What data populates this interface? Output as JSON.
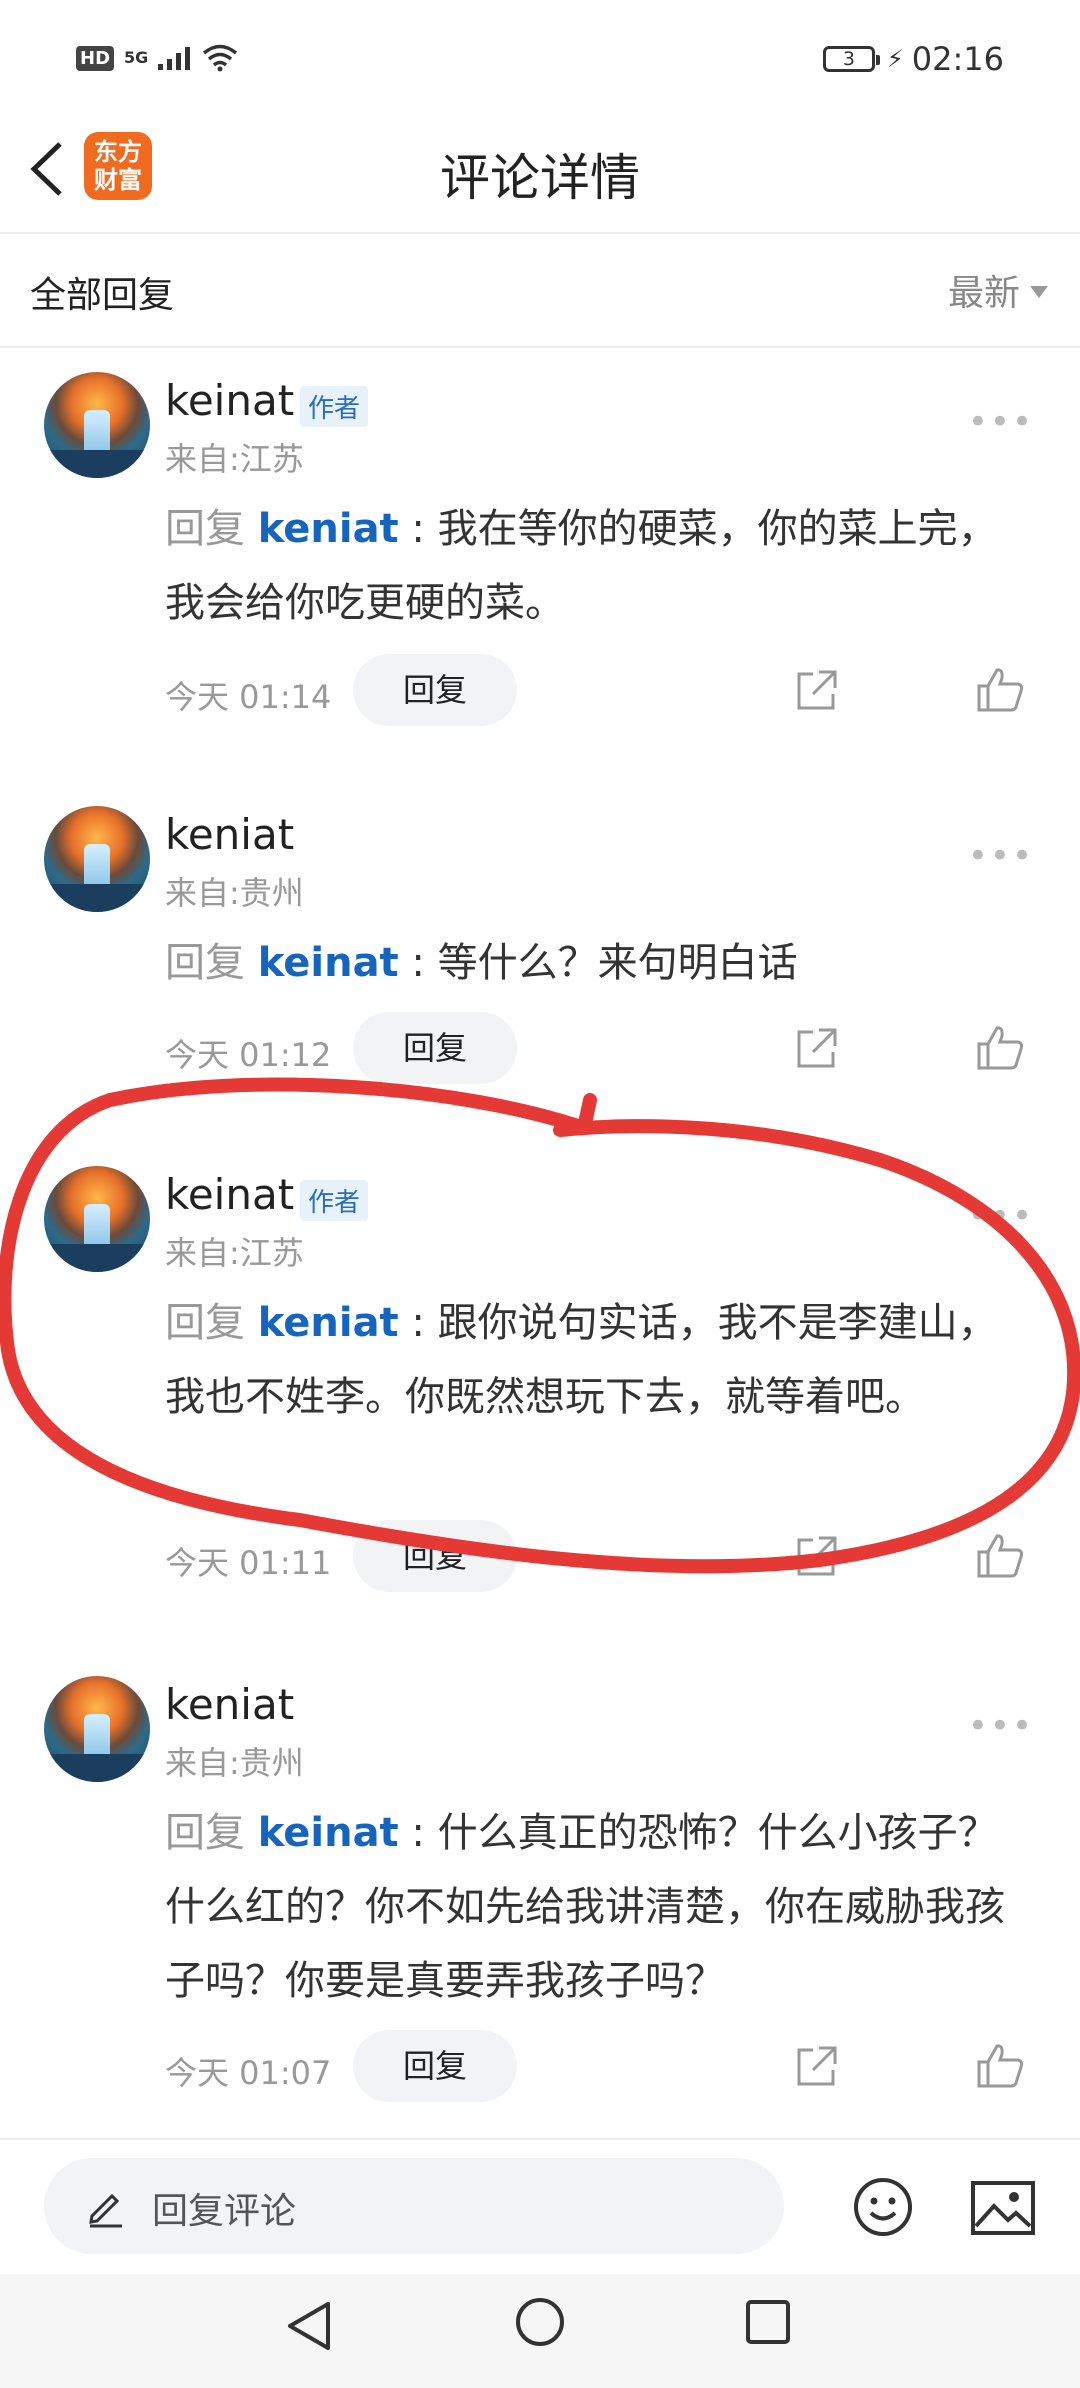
{
  "status_bar": {
    "hd": "HD",
    "network": "5G",
    "battery": "3",
    "time": "02:16"
  },
  "header": {
    "logo_line1": "东方",
    "logo_line2": "财富",
    "title": "评论详情"
  },
  "filter": {
    "label": "全部回复",
    "sort": "最新"
  },
  "comments": [
    {
      "user": "keinat",
      "author_tag": "作者",
      "location": "来自:江苏",
      "reply_prefix": "回复",
      "reply_to": "keniat",
      "text": "我在等你的硬菜，你的菜上完，我会给你吃更硬的菜。",
      "time": "今天 01:14",
      "reply_label": "回复"
    },
    {
      "user": "keniat",
      "location": "来自:贵州",
      "reply_prefix": "回复",
      "reply_to": "keinat",
      "text": "等什么？来句明白话",
      "time": "今天 01:12",
      "reply_label": "回复"
    },
    {
      "user": "keinat",
      "author_tag": "作者",
      "location": "来自:江苏",
      "reply_prefix": "回复",
      "reply_to": "keniat",
      "text": "跟你说句实话，我不是李建山，我也不姓李。你既然想玩下去，就等着吧。",
      "time": "今天 01:11",
      "reply_label": "回复"
    },
    {
      "user": "keniat",
      "location": "来自:贵州",
      "reply_prefix": "回复",
      "reply_to": "keinat",
      "text": "什么真正的恐怖？什么小孩子？什么红的？你不如先给我讲清楚，你在威胁我孩子吗？你要是真要弄我孩子吗？",
      "time": "今天 01:07",
      "reply_label": "回复"
    }
  ],
  "bottom": {
    "placeholder": "回复评论"
  },
  "colors": {
    "accent_blue": "#1565c0",
    "logo_orange": "#f06b1f",
    "annotation_red": "#e53935"
  }
}
